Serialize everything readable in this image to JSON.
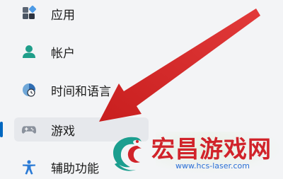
{
  "sidebar": {
    "items": [
      {
        "label": "应用",
        "icon": "apps-icon",
        "active": false
      },
      {
        "label": "帐户",
        "icon": "person-icon",
        "active": false
      },
      {
        "label": "时间和语言",
        "icon": "globe-clock-icon",
        "active": false
      },
      {
        "label": "游戏",
        "icon": "gamepad-icon",
        "active": true
      },
      {
        "label": "辅助功能",
        "icon": "accessibility-icon",
        "active": false
      }
    ]
  },
  "watermark": {
    "title": "宏昌游戏网",
    "url": "www.hcs-laser.com"
  },
  "colors": {
    "accent": "#0067c0",
    "arrow": "#e02424",
    "watermark_red": "#d1232a",
    "watermark_blue": "#2b6fd6"
  }
}
